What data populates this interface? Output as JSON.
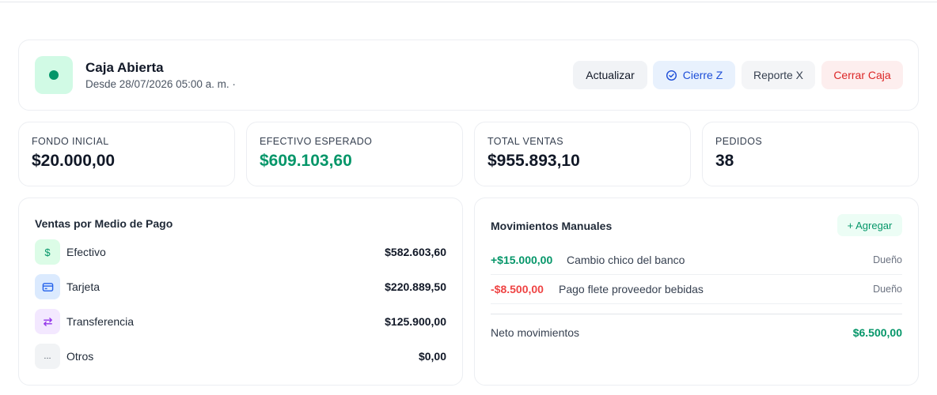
{
  "status": {
    "title": "Caja Abierta",
    "since": "Desde 28/07/2026 05:00 a. m. ·",
    "indicator_color": "#059669"
  },
  "actions": {
    "refresh": "Actualizar",
    "cierre_z": "Cierre Z",
    "cierre_z_icon": "check-circle-icon",
    "reporte_x": "Reporte X",
    "cerrar_caja": "Cerrar Caja"
  },
  "stats": [
    {
      "label": "FONDO INICIAL",
      "value": "$20.000,00"
    },
    {
      "label": "EFECTIVO ESPERADO",
      "value": "$609.103,60",
      "color": "#059669"
    },
    {
      "label": "TOTAL VENTAS",
      "value": "$955.893,10"
    },
    {
      "label": "PEDIDOS",
      "value": "38"
    }
  ],
  "payments": {
    "title": "Ventas por Medio de Pago",
    "items": [
      {
        "label": "Efectivo",
        "amount": "$582.603,60",
        "icon": "dollar-icon",
        "icon_text": "$",
        "color": "#059669"
      },
      {
        "label": "Tarjeta",
        "amount": "$220.889,50",
        "icon": "credit-card-icon",
        "color": "#2563eb"
      },
      {
        "label": "Transferencia",
        "amount": "$125.900,00",
        "icon": "transfer-arrows-icon",
        "color": "#9333ea"
      },
      {
        "label": "Otros",
        "amount": "$0,00",
        "icon": "ellipsis-icon",
        "icon_text": "...",
        "color": "#6b7280"
      }
    ]
  },
  "movements": {
    "title": "Movimientos Manuales",
    "add_label": "+ Agregar",
    "items": [
      {
        "amount": "+$15.000,00",
        "description": "Cambio chico del banco",
        "user": "Dueño"
      },
      {
        "amount": "-$8.500,00",
        "description": "Pago flete proveedor bebidas",
        "user": "Dueño"
      }
    ],
    "net_label": "Neto movimientos",
    "net_value": "$6.500,00"
  }
}
